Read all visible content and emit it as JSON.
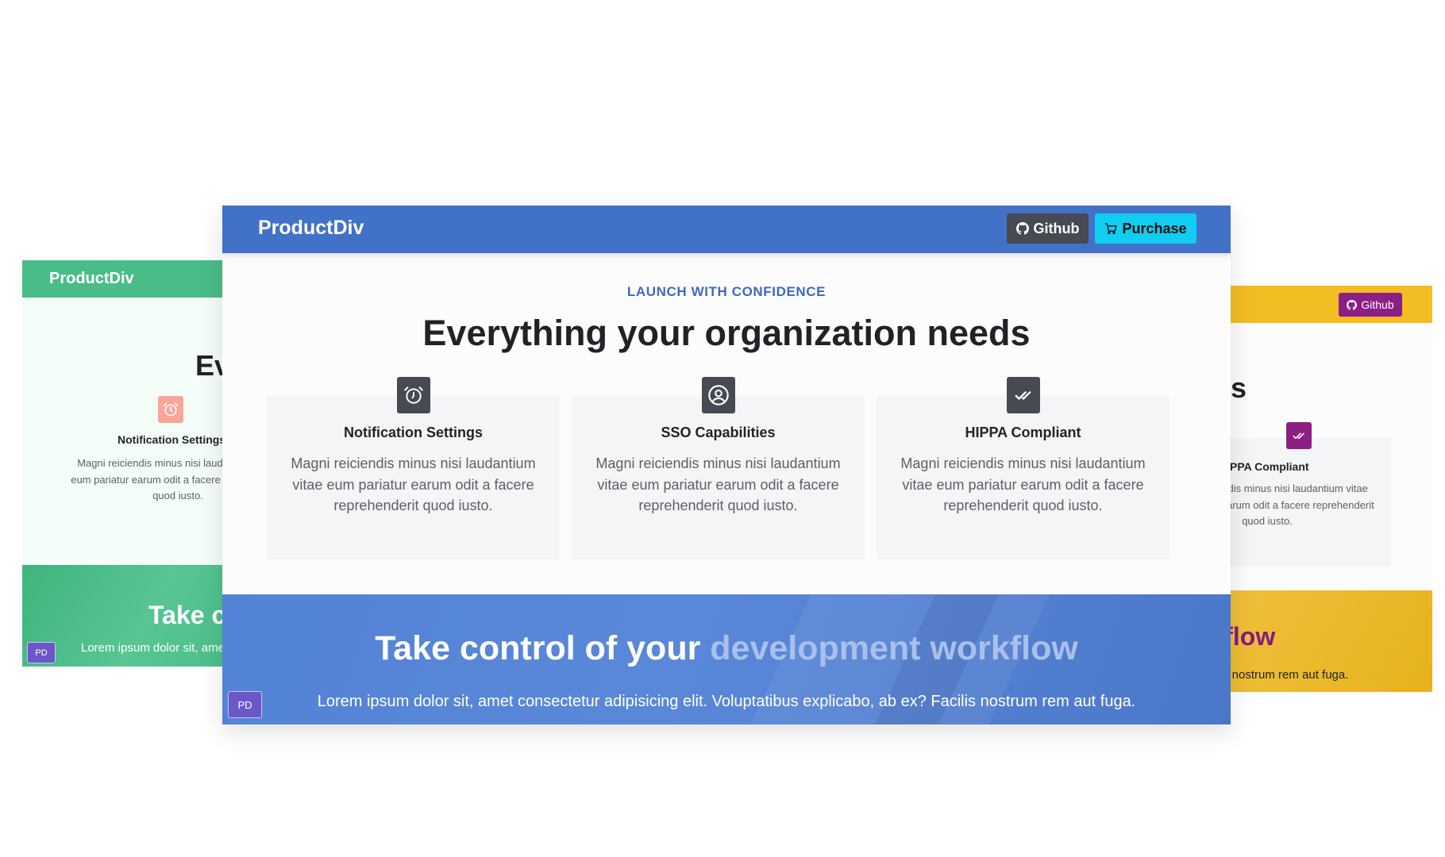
{
  "colors": {
    "main_nav": "#4271c8",
    "main_accent": "#3e69c0",
    "purchase_button": "#10cdf1",
    "github_button": "#474a52",
    "left_nav": "#49bd88",
    "right_nav": "#f3bd24",
    "right_accent": "#8c1f84"
  },
  "left_preview": {
    "brand": "ProductDiv",
    "heading_fragment": "Ev",
    "feature": {
      "icon": "alarm-clock-icon",
      "title": "Notification Settings",
      "description": "Magni reiciendis minus nisi laudantium vitae eum pariatur earum odit a facere reprehenderit quod iusto."
    },
    "cta": {
      "title_fragment": "Take c",
      "text": "Lorem ipsum dolor sit, amet consectetur"
    },
    "badge": "PD"
  },
  "right_preview": {
    "github_label": "Github",
    "heading_fragment": "ds",
    "feature": {
      "icon": "double-check-icon",
      "title": "HIPPA Compliant",
      "description": "Magni reiciendis minus nisi laudantium vitae eum pariatur earum odit a facere reprehenderit quod iusto."
    },
    "cta": {
      "title_fragment": "rkflow",
      "text_fragment": "ilis nostrum rem aut fuga."
    }
  },
  "main": {
    "brand": "ProductDiv",
    "github_label": "Github",
    "purchase_label": "Purchase",
    "eyebrow": "LAUNCH WITH CONFIDENCE",
    "heading": "Everything your organization needs",
    "features": [
      {
        "icon": "alarm-clock-icon",
        "title": "Notification Settings",
        "description": "Magni reiciendis minus nisi laudantium vitae eum pariatur earum odit a facere reprehenderit quod iusto."
      },
      {
        "icon": "user-circle-icon",
        "title": "SSO Capabilities",
        "description": "Magni reiciendis minus nisi laudantium vitae eum pariatur earum odit a facere reprehenderit quod iusto."
      },
      {
        "icon": "double-check-icon",
        "title": "HIPPA Compliant",
        "description": "Magni reiciendis minus nisi laudantium vitae eum pariatur earum odit a facere reprehenderit quod iusto."
      }
    ],
    "cta": {
      "title_main": "Take control of your",
      "title_accent": "development workflow",
      "text": "Lorem ipsum dolor sit, amet consectetur adipisicing elit. Voluptatibus explicabo, ab ex? Facilis nostrum rem aut fuga."
    },
    "badge": "PD"
  }
}
